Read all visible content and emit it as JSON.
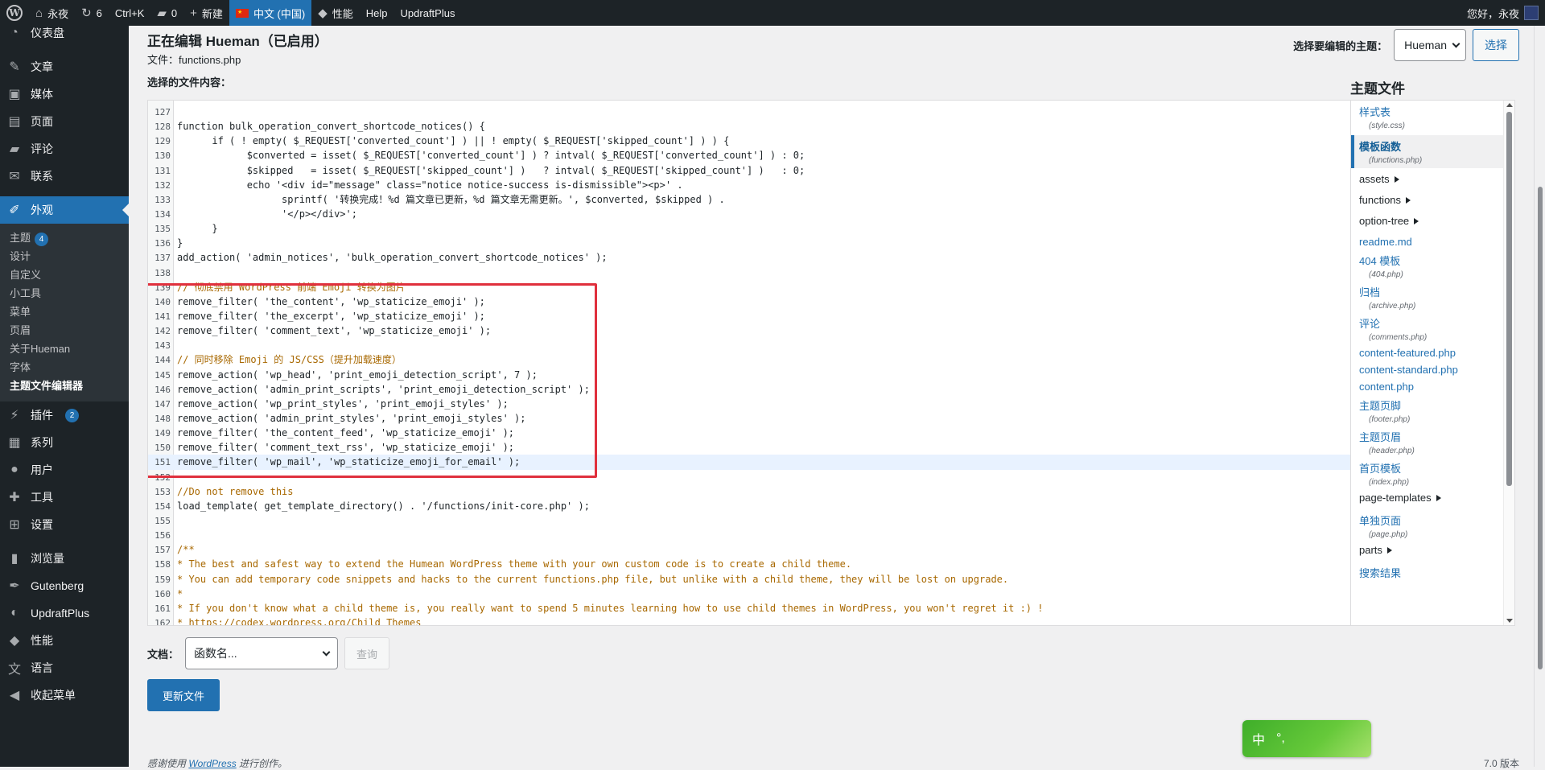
{
  "adminbar": {
    "site_name": "永夜",
    "updates_count": "6",
    "shortcut": "Ctrl+K",
    "comments_count": "0",
    "new_label": "新建",
    "language": "中文 (中国)",
    "performance": "性能",
    "help": "Help",
    "updraftplus": "UpdraftPlus",
    "greeting": "您好，永夜"
  },
  "sidebar": {
    "items_top": [
      {
        "label": "仪表盘",
        "icon": "dashboard-icon"
      },
      {
        "label": "文章",
        "icon": "pin-icon"
      },
      {
        "label": "媒体",
        "icon": "media-icon"
      },
      {
        "label": "页面",
        "icon": "page-icon"
      },
      {
        "label": "评论",
        "icon": "comment-icon"
      },
      {
        "label": "联系",
        "icon": "mail-icon"
      }
    ],
    "appearance_label": "外观",
    "submenu": [
      {
        "label": "主题",
        "badge": "4"
      },
      {
        "label": "设计"
      },
      {
        "label": "自定义"
      },
      {
        "label": "小工具"
      },
      {
        "label": "菜单"
      },
      {
        "label": "页眉"
      },
      {
        "label": "关于Hueman"
      },
      {
        "label": "字体"
      },
      {
        "label": "主题文件编辑器"
      }
    ],
    "items_bottom": [
      {
        "label": "插件",
        "badge": "2",
        "icon": "plugin-icon"
      },
      {
        "label": "系列",
        "icon": "series-icon"
      },
      {
        "label": "用户",
        "icon": "user-icon"
      },
      {
        "label": "工具",
        "icon": "tools-icon"
      },
      {
        "label": "设置",
        "icon": "settings-icon"
      },
      {
        "label": "浏览量",
        "icon": "chart-icon"
      },
      {
        "label": "Gutenberg",
        "icon": "gutenberg-icon"
      },
      {
        "label": "UpdraftPlus",
        "icon": "updraft-icon"
      },
      {
        "label": "性能",
        "icon": "performance-icon"
      },
      {
        "label": "语言",
        "icon": "language-icon"
      },
      {
        "label": "收起菜单",
        "icon": "collapse-icon"
      }
    ]
  },
  "header": {
    "title": "正在编辑 Hueman（已启用）",
    "file_prefix": "文件：",
    "file_name": "functions.php",
    "content_label": "选择的文件内容：",
    "select_theme_label": "选择要编辑的主题：",
    "selected_theme": "Hueman",
    "select_button": "选择"
  },
  "editor": {
    "lines": [
      {
        "n": "127",
        "t": ""
      },
      {
        "n": "128",
        "t": "function bulk_operation_convert_shortcode_notices() {"
      },
      {
        "n": "129",
        "t": "      if ( ! empty( $_REQUEST['converted_count'] ) || ! empty( $_REQUEST['skipped_count'] ) ) {"
      },
      {
        "n": "130",
        "t": "            $converted = isset( $_REQUEST['converted_count'] ) ? intval( $_REQUEST['converted_count'] ) : 0;"
      },
      {
        "n": "131",
        "t": "            $skipped   = isset( $_REQUEST['skipped_count'] )   ? intval( $_REQUEST['skipped_count'] )   : 0;"
      },
      {
        "n": "132",
        "t": "            echo '<div id=\"message\" class=\"notice notice-success is-dismissible\"><p>' ."
      },
      {
        "n": "133",
        "t": "                  sprintf( '转换完成！%d 篇文章已更新，%d 篇文章无需更新。', $converted, $skipped ) ."
      },
      {
        "n": "134",
        "t": "                  '</p></div>';"
      },
      {
        "n": "135",
        "t": "      }"
      },
      {
        "n": "136",
        "t": "}"
      },
      {
        "n": "137",
        "t": "add_action( 'admin_notices', 'bulk_operation_convert_shortcode_notices' );"
      },
      {
        "n": "138",
        "t": ""
      },
      {
        "n": "139",
        "t": "// 彻底禁用 WordPress 前端 Emoji 转换为图片",
        "c": "comment"
      },
      {
        "n": "140",
        "t": "remove_filter( 'the_content', 'wp_staticize_emoji' );"
      },
      {
        "n": "141",
        "t": "remove_filter( 'the_excerpt', 'wp_staticize_emoji' );"
      },
      {
        "n": "142",
        "t": "remove_filter( 'comment_text', 'wp_staticize_emoji' );"
      },
      {
        "n": "143",
        "t": ""
      },
      {
        "n": "144",
        "t": "// 同时移除 Emoji 的 JS/CSS（提升加载速度）",
        "c": "comment"
      },
      {
        "n": "145",
        "t": "remove_action( 'wp_head', 'print_emoji_detection_script', 7 );"
      },
      {
        "n": "146",
        "t": "remove_action( 'admin_print_scripts', 'print_emoji_detection_script' );"
      },
      {
        "n": "147",
        "t": "remove_action( 'wp_print_styles', 'print_emoji_styles' );"
      },
      {
        "n": "148",
        "t": "remove_action( 'admin_print_styles', 'print_emoji_styles' );"
      },
      {
        "n": "149",
        "t": "remove_filter( 'the_content_feed', 'wp_staticize_emoji' );"
      },
      {
        "n": "150",
        "t": "remove_filter( 'comment_text_rss', 'wp_staticize_emoji' );"
      },
      {
        "n": "151",
        "t": "remove_filter( 'wp_mail', 'wp_staticize_emoji_for_email' );",
        "c": "active"
      },
      {
        "n": "152",
        "t": ""
      },
      {
        "n": "153",
        "t": "//Do not remove this",
        "c": "comment"
      },
      {
        "n": "154",
        "t": "load_template( get_template_directory() . '/functions/init-core.php' );"
      },
      {
        "n": "155",
        "t": ""
      },
      {
        "n": "156",
        "t": ""
      },
      {
        "n": "157",
        "t": "/**",
        "c": "comment"
      },
      {
        "n": "158",
        "t": "* The best and safest way to extend the Humean WordPress theme with your own custom code is to create a child theme.",
        "c": "comment"
      },
      {
        "n": "159",
        "t": "* You can add temporary code snippets and hacks to the current functions.php file, but unlike with a child theme, they will be lost on upgrade.",
        "c": "comment"
      },
      {
        "n": "160",
        "t": "*",
        "c": "comment"
      },
      {
        "n": "161",
        "t": "* If you don't know what a child theme is, you really want to spend 5 minutes learning how to use child themes in WordPress, you won't regret it :) !",
        "c": "comment"
      },
      {
        "n": "162",
        "t": "* https://codex.wordpress.org/Child_Themes",
        "c": "comment"
      }
    ]
  },
  "file_tree": {
    "title": "主题文件",
    "entries": [
      {
        "kind": "file",
        "label": "样式表",
        "file": "(style.css)"
      },
      {
        "kind": "file",
        "label": "模板函数",
        "file": "(functions.php)",
        "current": true
      },
      {
        "kind": "folder",
        "label": "assets"
      },
      {
        "kind": "folder",
        "label": "functions"
      },
      {
        "kind": "folder",
        "label": "option-tree"
      },
      {
        "kind": "file",
        "label": "readme.md"
      },
      {
        "kind": "file",
        "label": "404 模板",
        "file": "(404.php)"
      },
      {
        "kind": "file",
        "label": "归档",
        "file": "(archive.php)"
      },
      {
        "kind": "file",
        "label": "评论",
        "file": "(comments.php)"
      },
      {
        "kind": "file",
        "label": "content-featured.php"
      },
      {
        "kind": "file",
        "label": "content-standard.php"
      },
      {
        "kind": "file",
        "label": "content.php"
      },
      {
        "kind": "file",
        "label": "主题页脚",
        "file": "(footer.php)"
      },
      {
        "kind": "file",
        "label": "主题页眉",
        "file": "(header.php)"
      },
      {
        "kind": "file",
        "label": "首页模板",
        "file": "(index.php)"
      },
      {
        "kind": "folder",
        "label": "page-templates"
      },
      {
        "kind": "file",
        "label": "单独页面",
        "file": "(page.php)"
      },
      {
        "kind": "folder",
        "label": "parts"
      },
      {
        "kind": "file",
        "label": "搜索结果"
      }
    ]
  },
  "bottom": {
    "doc_label": "文档：",
    "doc_placeholder": "函数名...",
    "lookup_button": "查询",
    "update_button": "更新文件",
    "footer_prefix": "感谢使用",
    "footer_link": "WordPress",
    "footer_suffix": "进行创作。",
    "version": "7.0 版本"
  },
  "ime": {
    "mode": "中",
    "punct": "°,"
  }
}
